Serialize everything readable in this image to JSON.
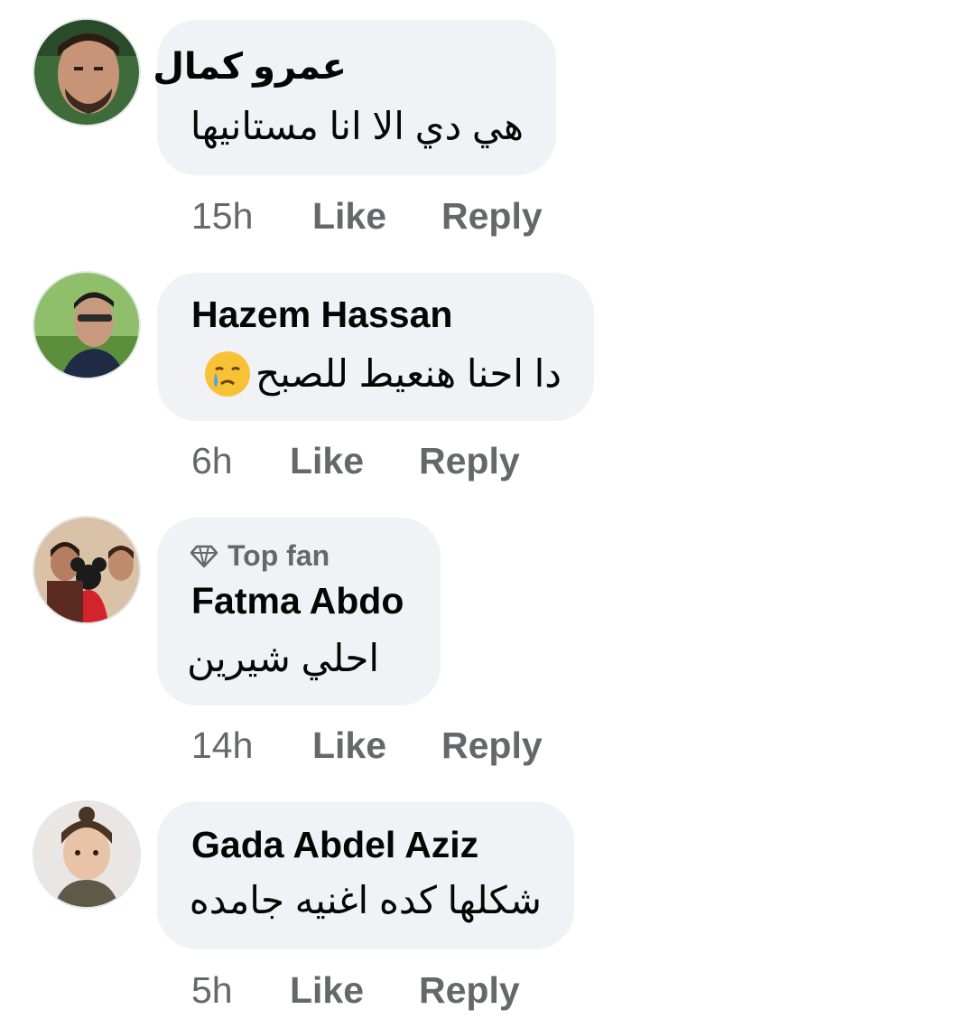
{
  "comments": [
    {
      "author": "عمرو كمال",
      "text": "هي دي الا انا مستانيها",
      "time": "15h",
      "like_label": "Like",
      "reply_label": "Reply"
    },
    {
      "author": "Hazem Hassan",
      "text": "دا احنا هنعيط للصبح",
      "emoji": "crying-face-emoji",
      "time": "6h",
      "like_label": "Like",
      "reply_label": "Reply"
    },
    {
      "badge": "Top fan",
      "badge_icon": "diamond-icon",
      "author": "Fatma Abdo",
      "text": "احلي شيرين",
      "time": "14h",
      "like_label": "Like",
      "reply_label": "Reply"
    },
    {
      "author": "Gada Abdel Aziz",
      "text": "شكلها كده اغنيه جامده",
      "time": "5h",
      "like_label": "Like",
      "reply_label": "Reply"
    }
  ],
  "colors": {
    "bubble": "#f0f2f5",
    "secondary_text": "#65676b",
    "primary_text": "#050505"
  }
}
